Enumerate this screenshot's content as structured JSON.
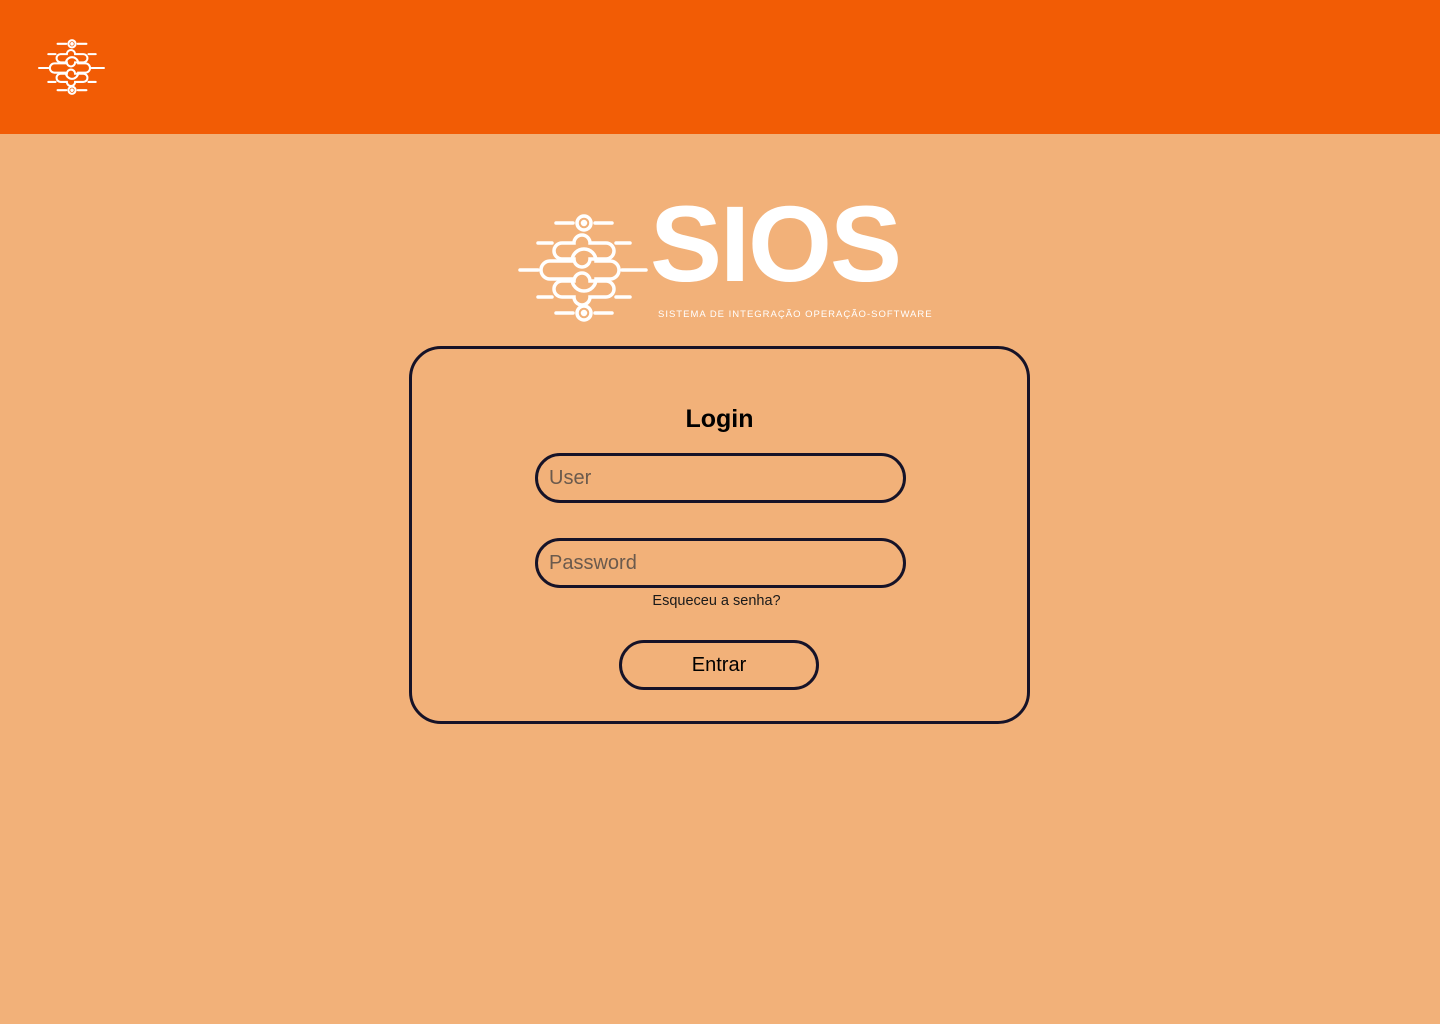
{
  "header": {
    "logo_icon": "sios-network-logo-icon",
    "background": "#F25C05"
  },
  "brand": {
    "name": "SIOS",
    "tagline": "SISTEMA DE INTEGRAÇÃO OPERAÇÃO-SOFTWARE",
    "icon": "sios-network-logo-icon"
  },
  "login": {
    "title": "Login",
    "user_placeholder": "User",
    "user_value": "",
    "password_placeholder": "Password",
    "password_value": "",
    "forgot_label": "Esqueceu a senha?",
    "submit_label": "Entrar"
  },
  "colors": {
    "page_background": "#F2B179",
    "header_background": "#F25C05",
    "border": "#161328",
    "logo": "#FFFFFF"
  }
}
